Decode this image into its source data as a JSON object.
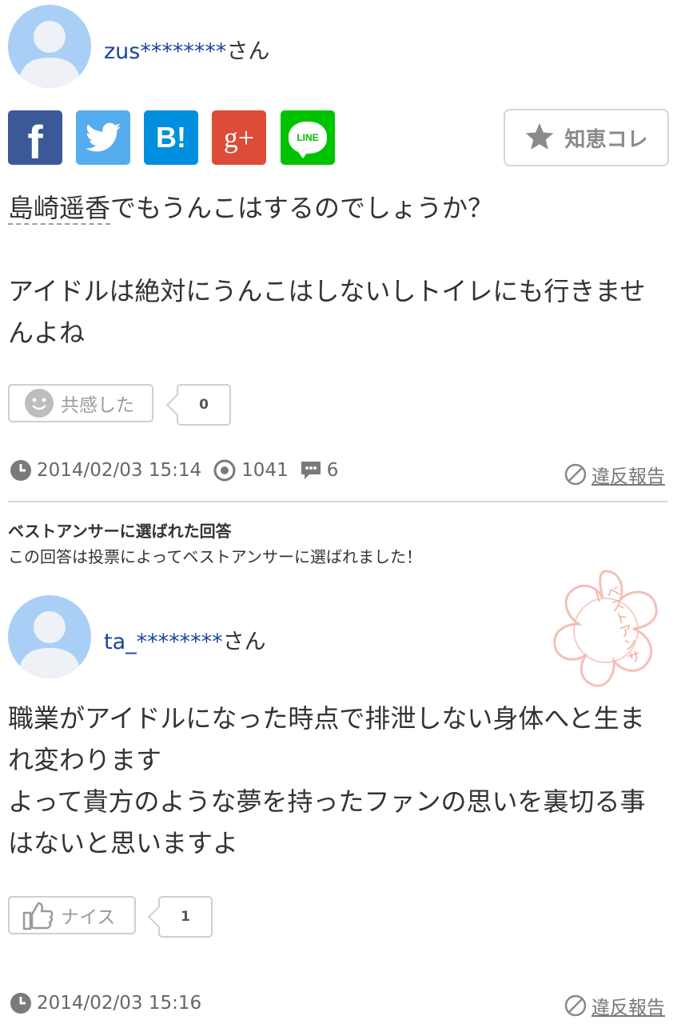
{
  "question": {
    "user": {
      "name": "zus********",
      "suffix": "さん"
    },
    "share": {
      "facebook": "f",
      "twitter": "twitter-bird",
      "hatena": "B!",
      "googleplus": "g+",
      "line": "LINE",
      "chie_kore": "知恵コレ"
    },
    "keyword": "島崎遥香",
    "line1_rest": "でもうんこはするのでしょうか？",
    "line2": "アイドルは絶対にうんこはしないしトイレにも行きませ",
    "line3": "んよね",
    "empathy_label": "共感した",
    "empathy_count": "0",
    "date": "2014/02/03 15:14",
    "views": "1041",
    "answers": "6",
    "report": "違反報告"
  },
  "best_answer": {
    "heading": "ベストアンサーに選ばれた回答",
    "subheading": "この回答は投票によってベストアンサーに選ばれました！",
    "stamp_text": "ベストアンサー",
    "user": {
      "name": "ta_********",
      "suffix": "さん"
    },
    "line1": "職業がアイドルになった時点で排泄しない身体へと生ま",
    "line2": "れ変わります",
    "line3": "よって貴方のような夢を持ったファンの思いを裏切る事",
    "line4": "はないと思いますよ",
    "nice_label": "ナイス",
    "nice_count": "1",
    "date": "2014/02/03 15:16",
    "report": "違反報告"
  },
  "colors": {
    "username": "#1a44a0",
    "avatar": "#a9cff6",
    "facebook": "#3b5998",
    "twitter": "#55acee",
    "hatena": "#008fde",
    "googleplus": "#dd4b39",
    "line": "#00c300",
    "stamp": "#f3b9b2"
  }
}
